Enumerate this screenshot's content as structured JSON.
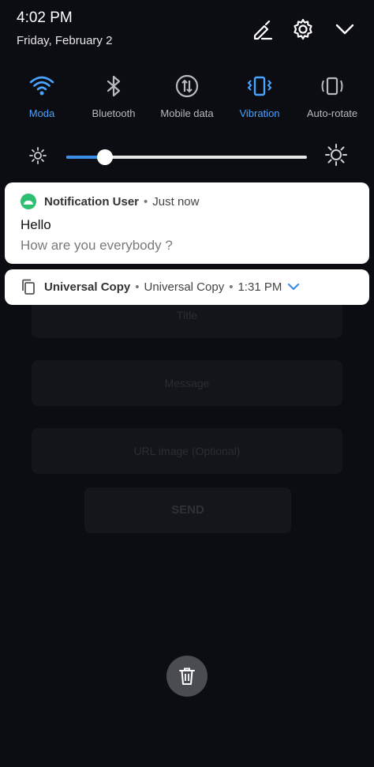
{
  "header": {
    "time": "4:02 PM",
    "date": "Friday, February 2",
    "icons": [
      "edit-icon",
      "settings-gear-icon",
      "collapse-chevron-icon"
    ]
  },
  "toggles": [
    {
      "label": "Moda",
      "icon": "wifi-icon",
      "active": true
    },
    {
      "label": "Bluetooth",
      "icon": "bluetooth-icon",
      "active": false
    },
    {
      "label": "Mobile data",
      "icon": "mobile-data-icon",
      "active": false
    },
    {
      "label": "Vibration",
      "icon": "vibration-icon",
      "active": true
    },
    {
      "label": "Auto-rotate",
      "icon": "auto-rotate-icon",
      "active": false
    }
  ],
  "brightness": {
    "level": 0.16,
    "low_icon": "brightness-low-icon",
    "high_icon": "brightness-high-icon"
  },
  "notifications": [
    {
      "app": "Notification User",
      "time": "Just now",
      "title": "Hello",
      "body": "How are you everybody ?"
    },
    {
      "app": "Universal Copy",
      "subtext": "Universal Copy",
      "time": "1:31 PM"
    }
  ],
  "background_app": {
    "title_placeholder": "Title",
    "message_placeholder": "Message",
    "url_placeholder": "URL image (Optional)",
    "send_label": "SEND"
  },
  "clear_all": {
    "icon": "trash-icon"
  },
  "colors": {
    "accent": "#4aa3ff",
    "app_dot": "#2fbf71",
    "background": "#0b0d12"
  }
}
